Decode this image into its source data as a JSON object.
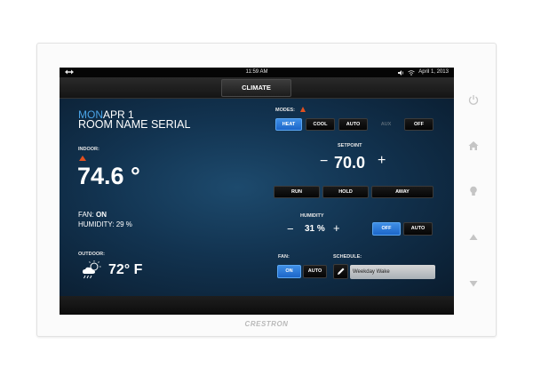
{
  "status": {
    "time": "11:59 AM",
    "date": "April 1, 2013"
  },
  "header": {
    "title": "CLIMATE"
  },
  "left": {
    "day": "MON",
    "date": "APR 1",
    "room": "ROOM NAME SERIAL",
    "indoor_label": "INDOOR:",
    "indoor_temp": "74.6 °",
    "fan_label": "FAN:",
    "fan_value": "ON",
    "humidity_label": "HUMIDITY:",
    "humidity_value": "29 %",
    "outdoor_label": "OUTDOOR:",
    "outdoor_temp": "72° F"
  },
  "modes": {
    "label": "MODES:",
    "buttons": [
      "HEAT",
      "COOL",
      "AUTO",
      "AUX",
      "OFF"
    ],
    "active": "HEAT"
  },
  "setpoint": {
    "label": "SETPOINT",
    "minus": "−",
    "value": "70.0",
    "plus": "+"
  },
  "schedule_mode": {
    "buttons": [
      "RUN",
      "HOLD",
      "AWAY"
    ]
  },
  "humidity": {
    "label": "HUMIDITY",
    "minus": "−",
    "value": "31 %",
    "plus": "+",
    "buttons": [
      "OFF",
      "AUTO"
    ],
    "active": "OFF"
  },
  "fan": {
    "label": "FAN:",
    "buttons": [
      "ON",
      "AUTO"
    ],
    "active": "ON"
  },
  "schedule": {
    "label": "SCHEDULE:",
    "value": "Weekday Wake"
  },
  "brand": "CRESTRON",
  "colors": {
    "accent": "#2f7fdc",
    "day_text": "#4aa3e6",
    "alert": "#e2501f"
  }
}
